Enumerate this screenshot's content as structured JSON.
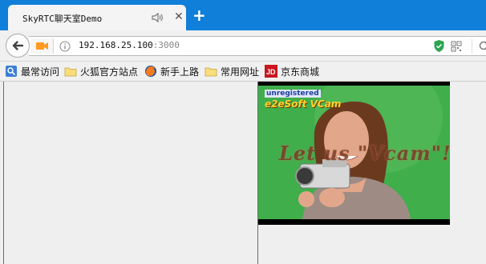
{
  "browser": {
    "tab": {
      "title": "SkyRTC聊天室Demo",
      "audio_icon": "speaker-icon",
      "close_label": "✕"
    },
    "new_tab_label": "+",
    "address": {
      "host": "192.168.25.100",
      "port": ":3000"
    }
  },
  "bookmarks": [
    {
      "label": "最常访问",
      "icon": "bookmark-search-icon"
    },
    {
      "label": "火狐官方站点",
      "icon": "folder-icon"
    },
    {
      "label": "新手上路",
      "icon": "firefox-icon"
    },
    {
      "label": "常用网址",
      "icon": "folder-icon"
    },
    {
      "label": "京东商城",
      "icon": "jd-icon"
    }
  ],
  "video": {
    "watermark_top": "unregistered",
    "watermark_brand": "e2eSoft VCam",
    "caption": "Let us \"Vcam\"!"
  },
  "colors": {
    "tabstrip": "#0f7fd9",
    "urlbar_shield": "#2da44e",
    "video_bg": "#3fae4b",
    "jd_red": "#c9151e"
  }
}
